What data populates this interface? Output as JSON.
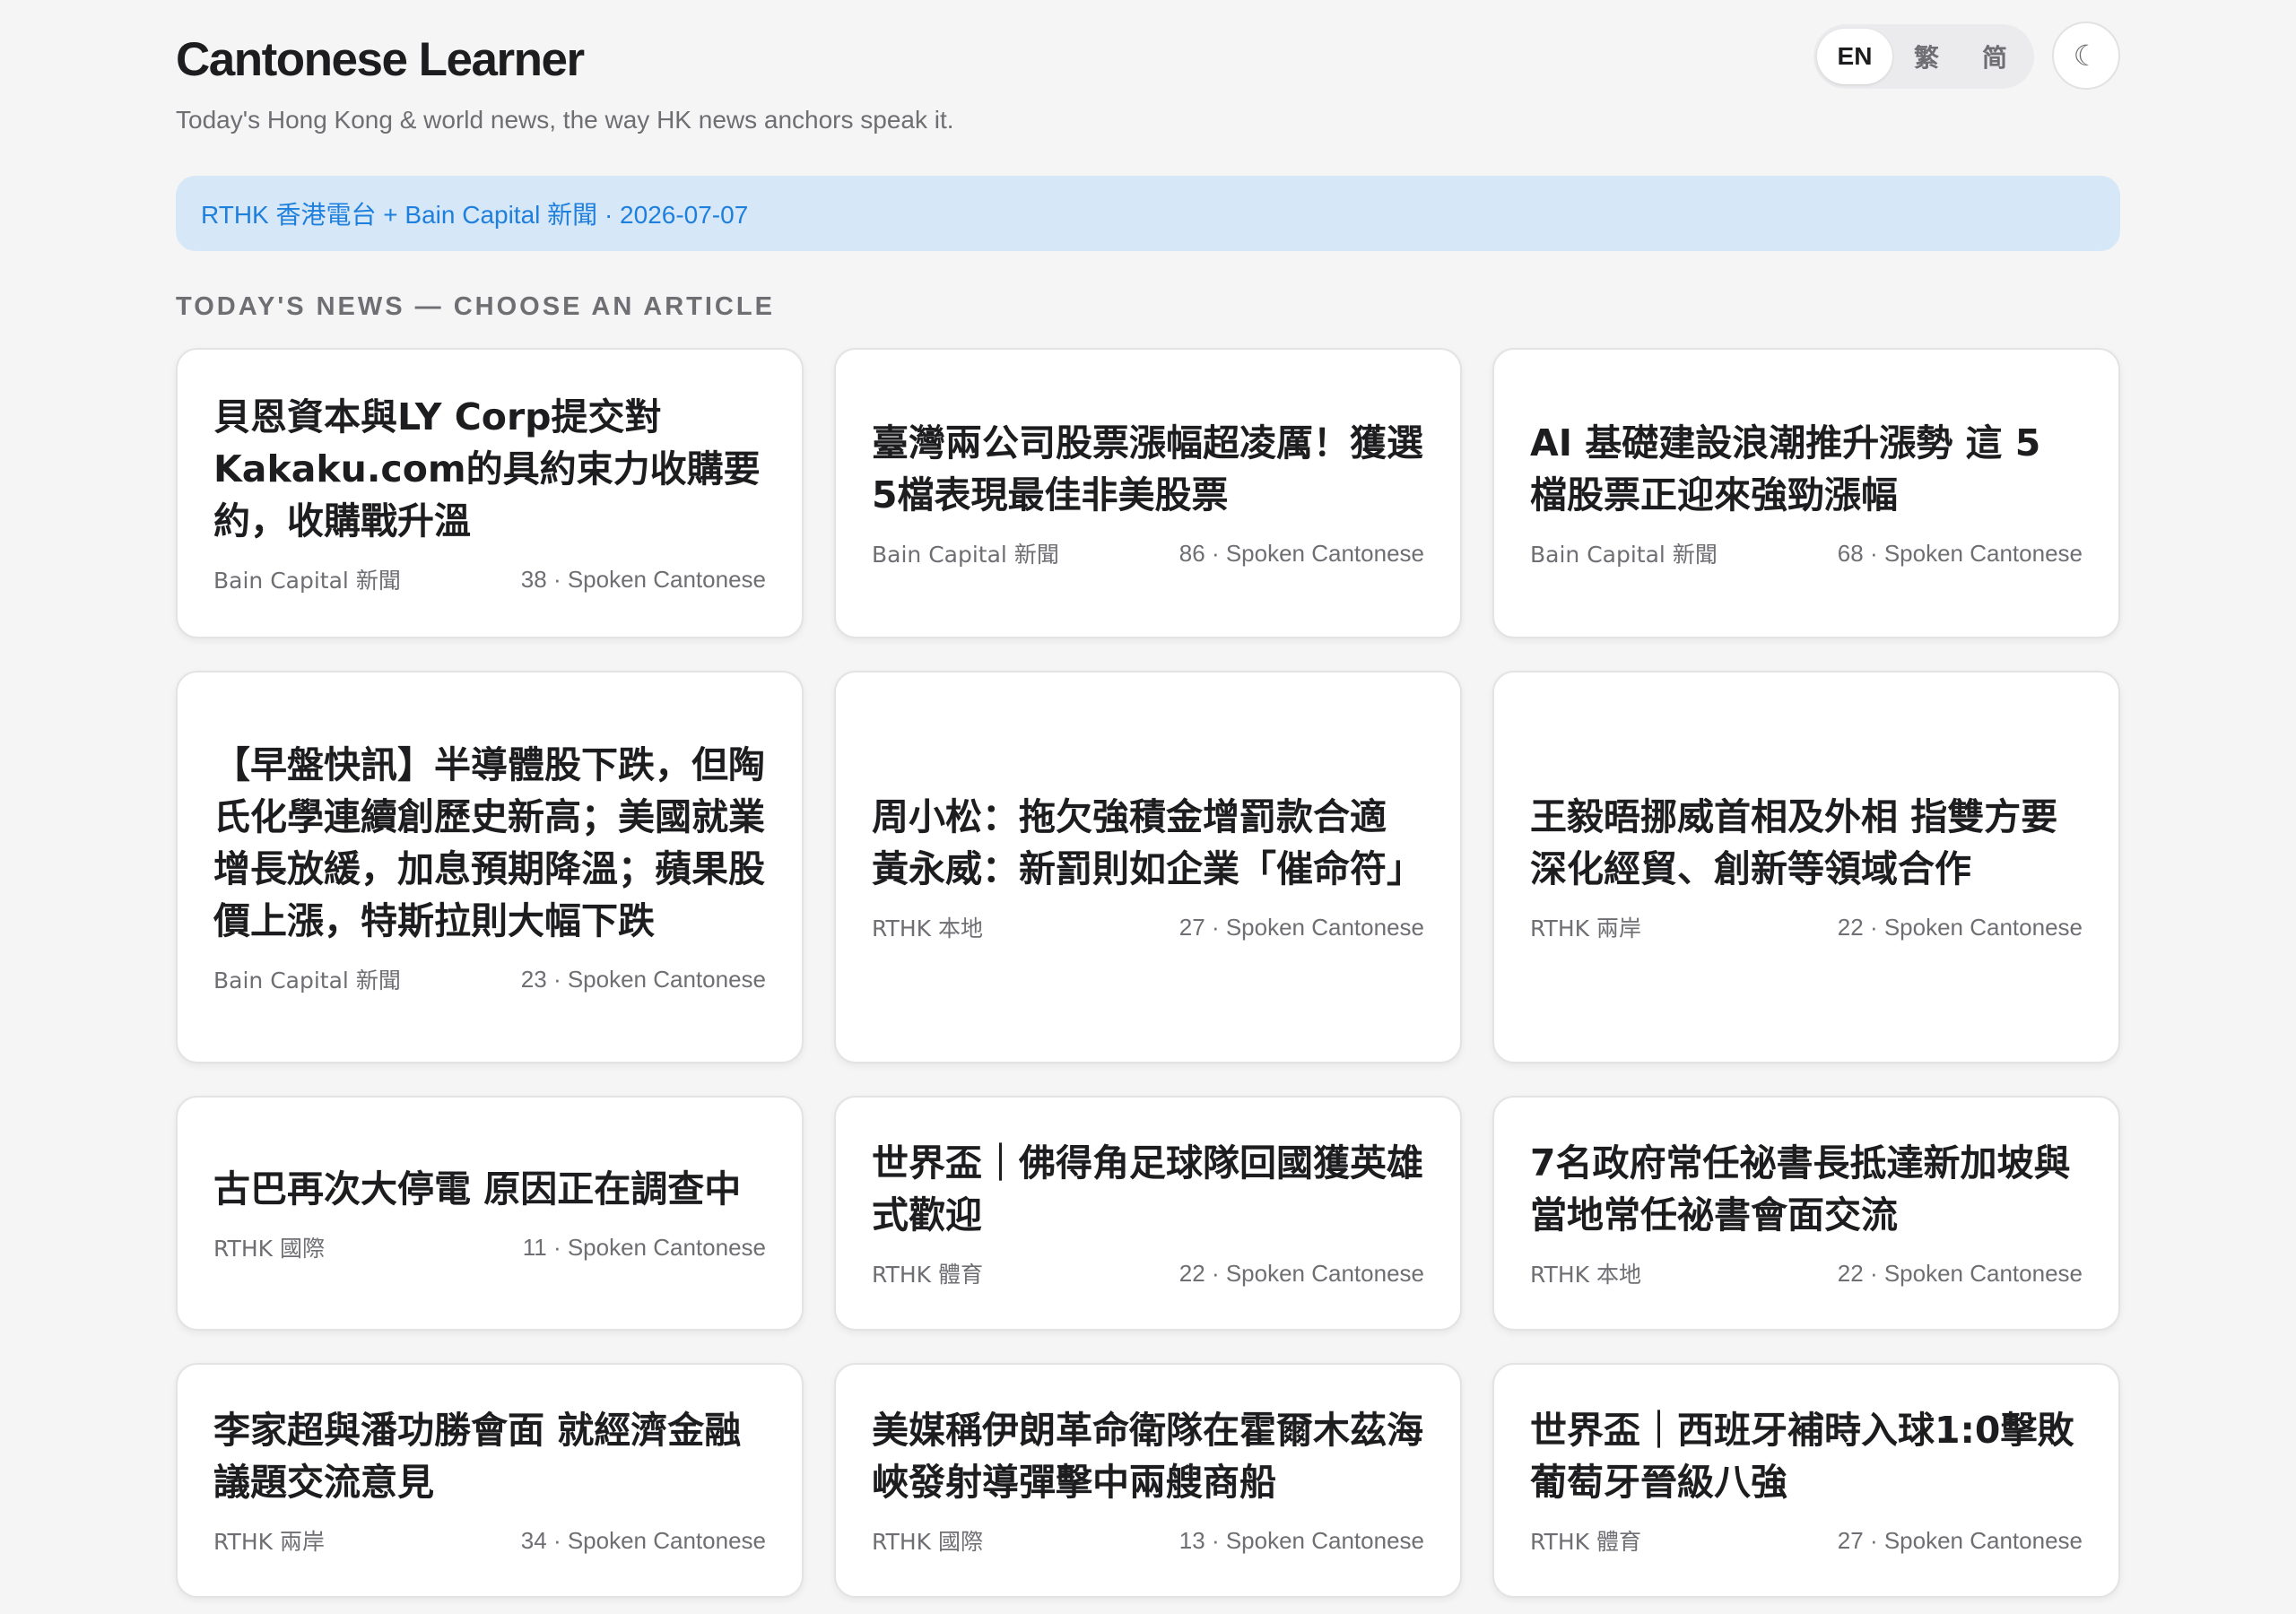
{
  "header": {
    "title": "Cantonese Learner",
    "subtitle": "Today's Hong Kong & world news, the way HK news anchors speak it.",
    "lang": {
      "en": "EN",
      "trad": "繁",
      "simp": "简"
    },
    "theme_icon": "☾"
  },
  "banner": {
    "text": "RTHK 香港電台 + Bain Capital 新聞 · 2026-07-07"
  },
  "section": {
    "heading": "Today's news — choose an article"
  },
  "articles": [
    {
      "title": "貝恩資本與LY Corp提交對Kakaku.com的具約束力收購要約，收購戰升溫",
      "source": "Bain Capital 新聞",
      "stats": "38 · Spoken Cantonese"
    },
    {
      "title": "臺灣兩公司股票漲幅超凌厲！獲選5檔表現最佳非美股票",
      "source": "Bain Capital 新聞",
      "stats": "86 · Spoken Cantonese"
    },
    {
      "title": "AI 基礎建設浪潮推升漲勢 這 5 檔股票正迎來強勁漲幅",
      "source": "Bain Capital 新聞",
      "stats": "68 · Spoken Cantonese"
    },
    {
      "title": "【早盤快訊】半導體股下跌，但陶氏化學連續創歷史新高；美國就業增長放緩，加息預期降溫；蘋果股價上漲，特斯拉則大幅下跌",
      "source": "Bain Capital 新聞",
      "stats": "23 · Spoken Cantonese"
    },
    {
      "title": "周小松：拖欠強積金增罰款合適 黃永威：新罰則如企業「催命符」",
      "source": "RTHK 本地",
      "stats": "27 · Spoken Cantonese"
    },
    {
      "title": "王毅晤挪威首相及外相 指雙方要深化經貿、創新等領域合作",
      "source": "RTHK 兩岸",
      "stats": "22 · Spoken Cantonese"
    },
    {
      "title": "古巴再次大停電 原因正在調查中",
      "source": "RTHK 國際",
      "stats": "11 · Spoken Cantonese"
    },
    {
      "title": "世界盃｜佛得角足球隊回國獲英雄式歡迎",
      "source": "RTHK 體育",
      "stats": "22 · Spoken Cantonese"
    },
    {
      "title": "7名政府常任祕書長抵達新加坡與當地常任祕書會面交流",
      "source": "RTHK 本地",
      "stats": "22 · Spoken Cantonese"
    },
    {
      "title": "李家超與潘功勝會面 就經濟金融議題交流意見",
      "source": "RTHK 兩岸",
      "stats": "34 · Spoken Cantonese"
    },
    {
      "title": "美媒稱伊朗革命衛隊在霍爾木茲海峽發射導彈擊中兩艘商船",
      "source": "RTHK 國際",
      "stats": "13 · Spoken Cantonese"
    },
    {
      "title": "世界盃｜西班牙補時入球1:0擊敗葡萄牙晉級八強",
      "source": "RTHK 體育",
      "stats": "27 · Spoken Cantonese"
    }
  ]
}
